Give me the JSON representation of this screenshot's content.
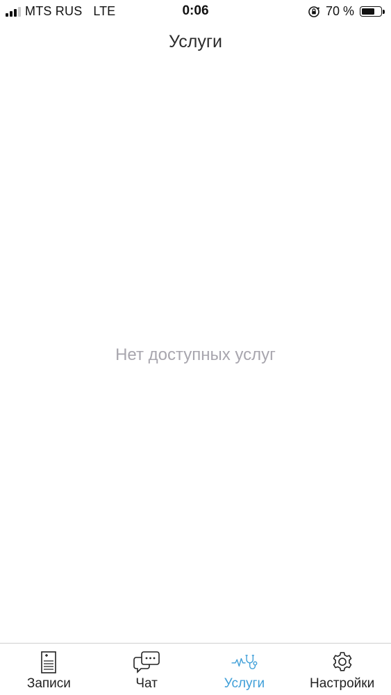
{
  "status_bar": {
    "carrier": "MTS RUS",
    "network": "LTE",
    "time": "0:06",
    "battery_percent_label": "70 %",
    "battery_level": 0.7
  },
  "nav": {
    "title": "Услуги"
  },
  "empty_state": {
    "message": "Нет доступных услуг"
  },
  "tab_bar": {
    "active_tab": "services",
    "active_color": "#3f9fd8",
    "tabs": [
      {
        "id": "records",
        "label": "Записи",
        "icon": "medical-record-icon"
      },
      {
        "id": "chat",
        "label": "Чат",
        "icon": "chat-bubbles-icon"
      },
      {
        "id": "services",
        "label": "Услуги",
        "icon": "stethoscope-icon"
      },
      {
        "id": "settings",
        "label": "Настройки",
        "icon": "gear-icon"
      }
    ]
  }
}
